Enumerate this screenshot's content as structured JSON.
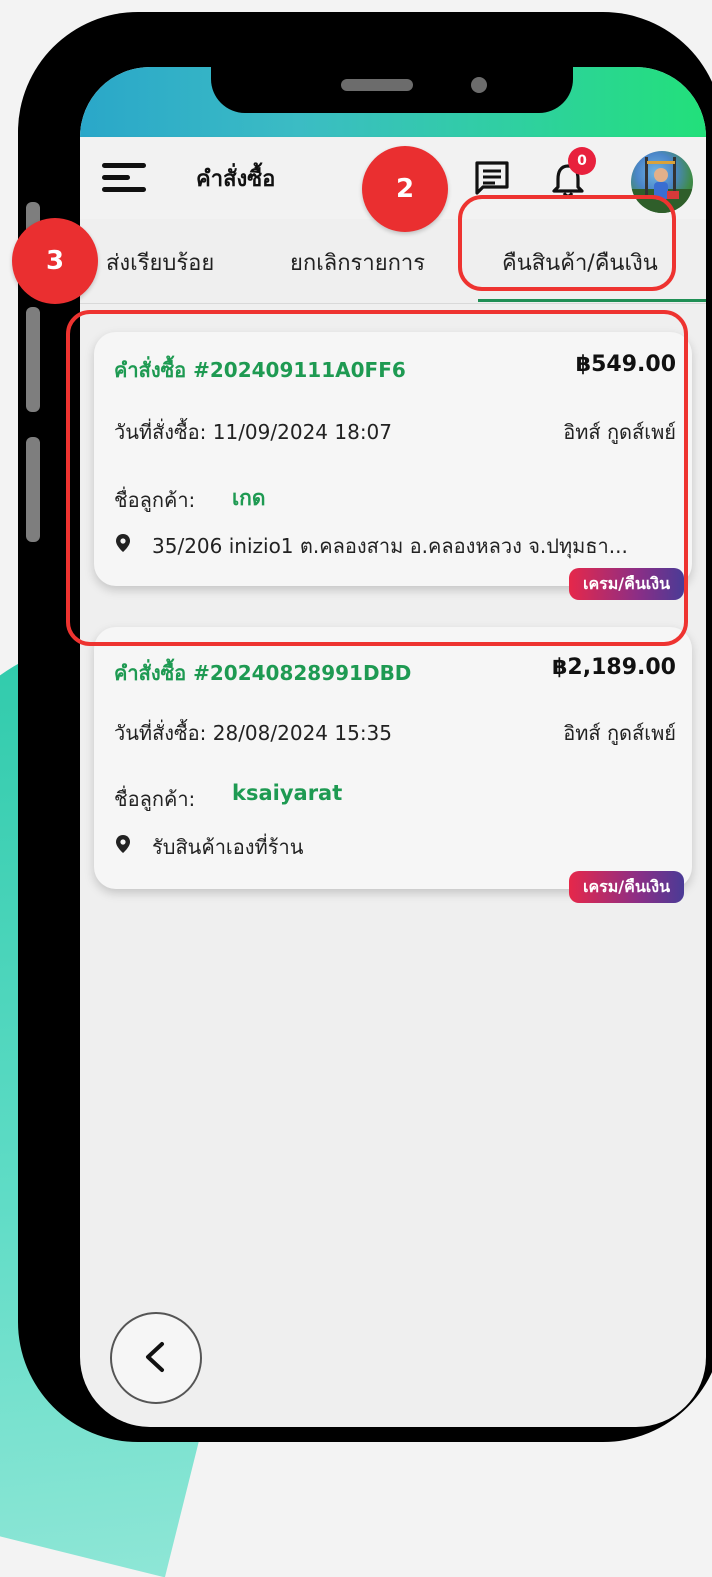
{
  "appbar": {
    "title": "คำสั่งซื้อ",
    "notification_count": "0"
  },
  "tabs": [
    {
      "label": "ส่งเรียบร้อย"
    },
    {
      "label": "ยกเลิกรายการ"
    },
    {
      "label": "คืนสินค้า/คืนเงิน",
      "active": true
    }
  ],
  "orders": [
    {
      "order_no": "คำสั่งซื้อ #202409111A0FF6",
      "amount": "฿549.00",
      "date": "วันที่สั่งซื้อ: 11/09/2024 18:07",
      "shop": "อิทส์ กูดส์เพย์",
      "customer_label": "ชื่อลูกค้า:",
      "customer_name": "เกด",
      "address": "35/206 inizio1 ต.คลองสาม อ.คลองหลวง จ.ปทุมธา...",
      "status": "เครม/คืนเงิน"
    },
    {
      "order_no": "คำสั่งซื้อ #20240828991DBD",
      "amount": "฿2,189.00",
      "date": "วันที่สั่งซื้อ: 28/08/2024 15:35",
      "shop": "อิทส์ กูดส์เพย์",
      "customer_label": "ชื่อลูกค้า:",
      "customer_name": "ksaiyarat",
      "address": "รับสินค้าเองที่ร้าน",
      "status": "เครม/คืนเงิน"
    }
  ],
  "annotations": {
    "marker_2": "2",
    "marker_3": "3",
    "highlight_color": "#ee3330"
  },
  "colors": {
    "accent_green": "#1e9a52",
    "badge_gradient_start": "#e6284a",
    "badge_gradient_end": "#4a3b96",
    "notification_red": "#e8213d"
  }
}
